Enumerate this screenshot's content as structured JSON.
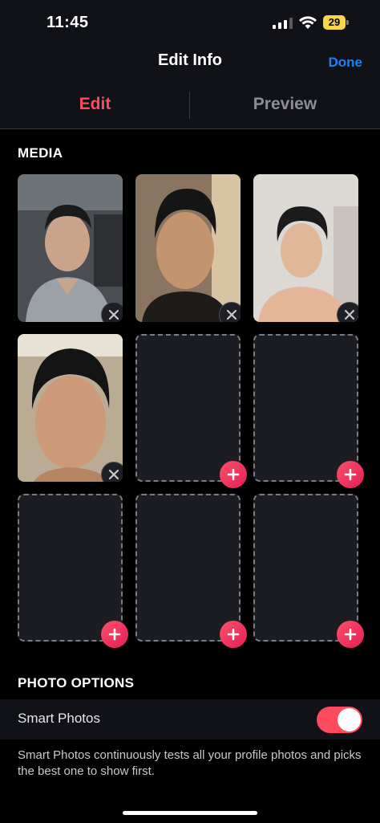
{
  "status_bar": {
    "time": "11:45",
    "battery": "29",
    "icons": [
      "signal-icon",
      "wifi-icon",
      "battery-icon"
    ]
  },
  "header": {
    "title": "Edit Info",
    "done_label": "Done"
  },
  "tabs": [
    {
      "label": "Edit",
      "active": true
    },
    {
      "label": "Preview",
      "active": false
    }
  ],
  "media": {
    "heading": "MEDIA",
    "slots": [
      {
        "filled": true,
        "action": "remove"
      },
      {
        "filled": true,
        "action": "remove"
      },
      {
        "filled": true,
        "action": "remove"
      },
      {
        "filled": true,
        "action": "remove"
      },
      {
        "filled": false,
        "action": "add"
      },
      {
        "filled": false,
        "action": "add"
      },
      {
        "filled": false,
        "action": "add"
      },
      {
        "filled": false,
        "action": "add"
      },
      {
        "filled": false,
        "action": "add"
      }
    ]
  },
  "photo_options": {
    "heading": "PHOTO OPTIONS",
    "smart_photos": {
      "label": "Smart Photos",
      "enabled": true,
      "description": "Smart Photos continuously tests all your profile photos and picks the best one to show first."
    }
  },
  "colors": {
    "accent": "#fd4a5c",
    "link": "#1a82f5",
    "background": "#000000",
    "surface": "#111217"
  }
}
